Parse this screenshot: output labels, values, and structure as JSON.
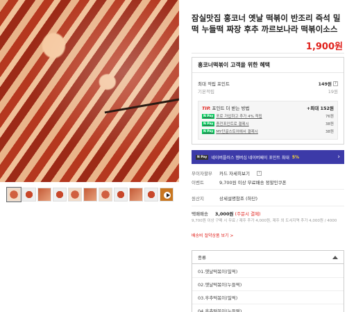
{
  "product": {
    "title": "잠실맛집 홍코너 옛날 떡볶이 반조리 즉석 밀떡 누들떡 짜장 후추 까르보나라 떡볶이소스",
    "price": "1,900원"
  },
  "benefits": {
    "heading": "홍코너떡볶이 고객을 위한 혜택",
    "max_points_label": "최대 적립 포인트",
    "max_points_value": "149원",
    "basic_label": "기본적립",
    "basic_value": "19원",
    "tip_label": "TIP.",
    "tip_text": "포인트 더 받는 방법",
    "tip_max": "+최대 152원",
    "tips": [
      {
        "badge": "N Pay",
        "label": "포로 가입하고 추가 4% 적립",
        "value": "76원"
      },
      {
        "badge": "N Pay",
        "label": "충전포인트로 결제시",
        "value": "38원"
      },
      {
        "badge": "N Pay",
        "label": "MY단골스토어에서 결제시",
        "value": "38원"
      }
    ]
  },
  "banner": {
    "badge": "N Pay",
    "text": "네이버플러스 멤버십 네이버페이 포인트 최대",
    "percent": "5%",
    "arrow": "›"
  },
  "meta": {
    "installment_key": "무이자할부",
    "installment_value": "카드 자세히보기",
    "event_key": "이벤트",
    "event_value": "9,700원 이상 무료배송 정할인쿠폰",
    "origin_key": "원산지",
    "origin_value": "상세설명참조 (하단)"
  },
  "shipping": {
    "label": "택배배송",
    "fee": "3,000원",
    "cond": "(주문시 결제)",
    "note": "9,700원 이상 구매 시 무료 / 제주 추가 4,000원, 제주 외 도서지역 추가 4,000원 / 4000",
    "link": "배송비 절약상품 보기 >"
  },
  "options": {
    "label": "종류",
    "items": [
      "01.옛날떡볶이(밀떡)",
      "02.옛날떡볶이(누들떡)",
      "03.후추떡볶이(밀떡)",
      "04.후추떡볶이(누들떡)"
    ]
  },
  "colors": {
    "accent": "#e0201b",
    "banner": "#3c3aa8",
    "npay": "#03c75a"
  },
  "icons": {
    "play": "play-icon",
    "help": "question-icon",
    "caret": "caret-up-icon"
  }
}
